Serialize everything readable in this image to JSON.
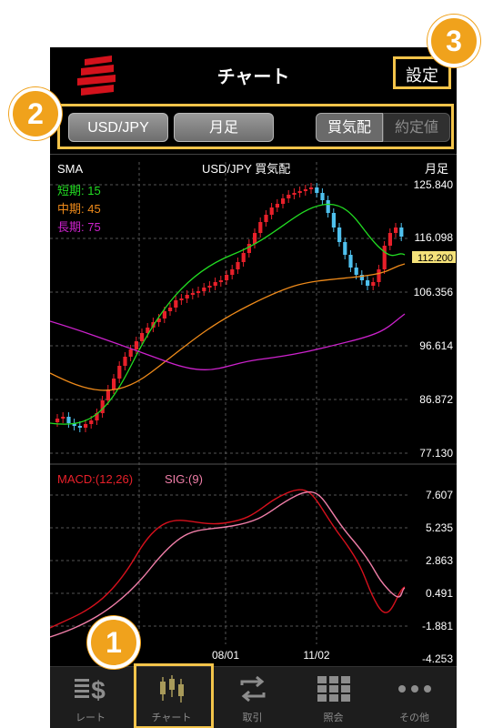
{
  "header": {
    "title": "チャート",
    "settings_label": "設定"
  },
  "toolbar": {
    "symbol": "USD/JPY",
    "period": "月足",
    "price_bid": "買気配",
    "price_trade": "約定値"
  },
  "chart": {
    "indicator": "SMA",
    "symbol_label": "USD/JPY  買気配",
    "period_label": "月足",
    "legend": [
      {
        "label": "短期: 15",
        "color": "#22dd22"
      },
      {
        "label": "中期: 45",
        "color": "#ee8a1a"
      },
      {
        "label": "長期: 75",
        "color": "#cc22cc"
      }
    ],
    "price_ticks": [
      "125.840",
      "116.098",
      "106.356",
      "96.614",
      "86.872",
      "77.130"
    ],
    "current_price": "112.200",
    "macd_label": "MACD:(12,26)",
    "sig_label": "SIG:(9)",
    "macd_ticks": [
      "7.607",
      "5.235",
      "2.863",
      "0.491",
      "-1.881",
      "-4.253"
    ],
    "date_ticks": [
      "08/01",
      "11/02"
    ],
    "colors": {
      "up": "#e8202a",
      "down": "#4fc1ee",
      "macd": "#d6101c",
      "sig": "#f07ea8",
      "highlight": "#f3c44a",
      "badge": "#f0a21c"
    }
  },
  "tabs": [
    {
      "label": "レート",
      "icon": "rate-dollar-icon"
    },
    {
      "label": "チャート",
      "icon": "candlestick-icon"
    },
    {
      "label": "取引",
      "icon": "exchange-arrows-icon"
    },
    {
      "label": "照会",
      "icon": "grid-table-icon"
    },
    {
      "label": "その他",
      "icon": "more-dots-icon"
    }
  ],
  "badges": [
    "1",
    "2",
    "3"
  ]
}
